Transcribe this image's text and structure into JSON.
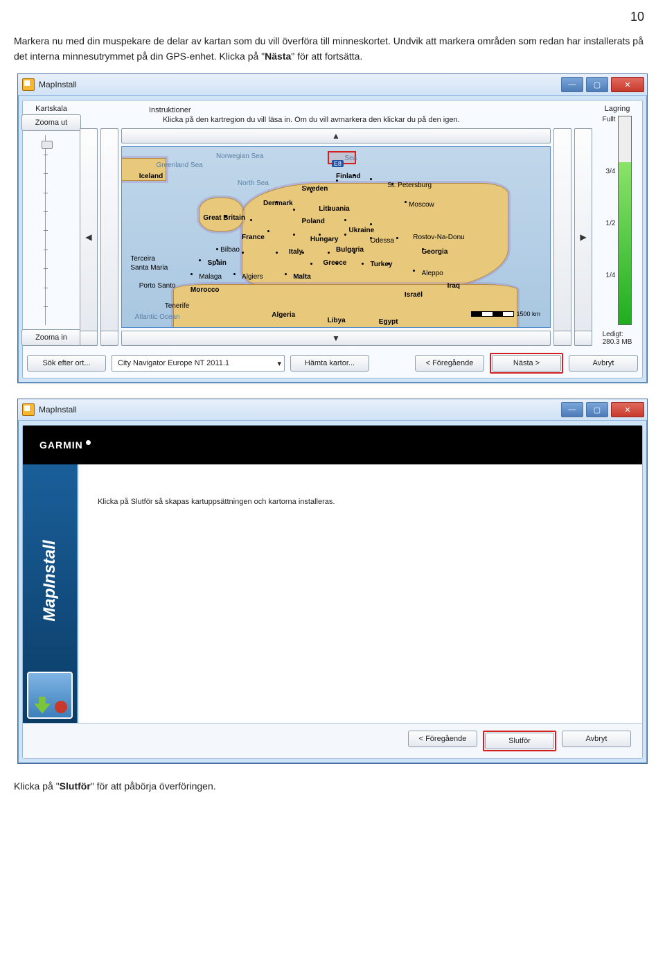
{
  "page_number": "10",
  "intro_text_1a": "Markera nu med din muspekare de delar av kartan som du vill överföra till minneskortet. Undvik att markera områden som redan har installerats på det interna minnesutrymmet på din GPS-enhet. Klicka på \"",
  "intro_text_1_bold": "Nästa",
  "intro_text_1b": "\" för att fortsätta.",
  "intro_text_2a": "Klicka på \"",
  "intro_text_2_bold": "Slutför",
  "intro_text_2b": "\" för att påbörja överföringen.",
  "screenshot1": {
    "window_title": "MapInstall",
    "scale": {
      "label": "Kartskala",
      "zoom_out": "Zooma ut",
      "zoom_in": "Zooma in"
    },
    "instruktioner_label": "Instruktioner",
    "instruktioner_text": "Klicka på den kartregion du vill läsa in. Om du vill avmarkera den klickar du på den igen.",
    "storage": {
      "label": "Lagring",
      "full": "Fullt",
      "m34": "3/4",
      "m12": "1/2",
      "m14": "1/4",
      "free_label": "Ledigt:",
      "free_value": "280.3 MB"
    },
    "map_labels": {
      "norwegian_sea": "Norwegian Sea",
      "greenland_sea": "Greenland Sea",
      "iceland": "Iceland",
      "north_sea": "North Sea",
      "finland": "Finland",
      "sweden": "Sweden",
      "st_pete": "St. Petersburg",
      "denmark": "Denmark",
      "lithuania": "Lithuania",
      "moscow": "Moscow",
      "gb": "Great Britain",
      "poland": "Poland",
      "ukraine": "Ukraine",
      "france": "France",
      "hungary": "Hungary",
      "rostov": "Rostov-Na-Donu",
      "odessa": "Odessa",
      "bilbao": "Bilbao",
      "italy": "Italy",
      "bulgaria": "Bulgaria",
      "georgia": "Georgia",
      "spain": "Spain",
      "greece": "Greece",
      "turkey": "Turkey",
      "terceira": "Terceira",
      "santa_maria": "Santa Maria",
      "porto_santo": "Porto Santo",
      "malaga": "Malaga",
      "algiers": "Algiers",
      "malta": "Malta",
      "aleppo": "Aleppo",
      "morocco": "Morocco",
      "tenerife": "Tenerife",
      "atlantic": "Atlantic Ocean",
      "algeria": "Algeria",
      "libya": "Libya",
      "egypt": "Egypt",
      "iraq": "Iraq",
      "israel": "Israël",
      "e8": "E8",
      "sea_label": "Sea",
      "scale": "1500 km"
    },
    "bottom": {
      "search": "Sök efter ort...",
      "product": "City Navigator Europe NT 2011.1",
      "fetch": "Hämta kartor...",
      "prev": "< Föregående",
      "next": "Nästa >",
      "cancel": "Avbryt"
    }
  },
  "screenshot2": {
    "window_title": "MapInstall",
    "brand": "GARMIN",
    "vtext": "MapInstall",
    "message": "Klicka på Slutför så skapas kartuppsättningen och kartorna installeras.",
    "prev": "< Föregående",
    "finish": "Slutför",
    "cancel": "Avbryt"
  }
}
